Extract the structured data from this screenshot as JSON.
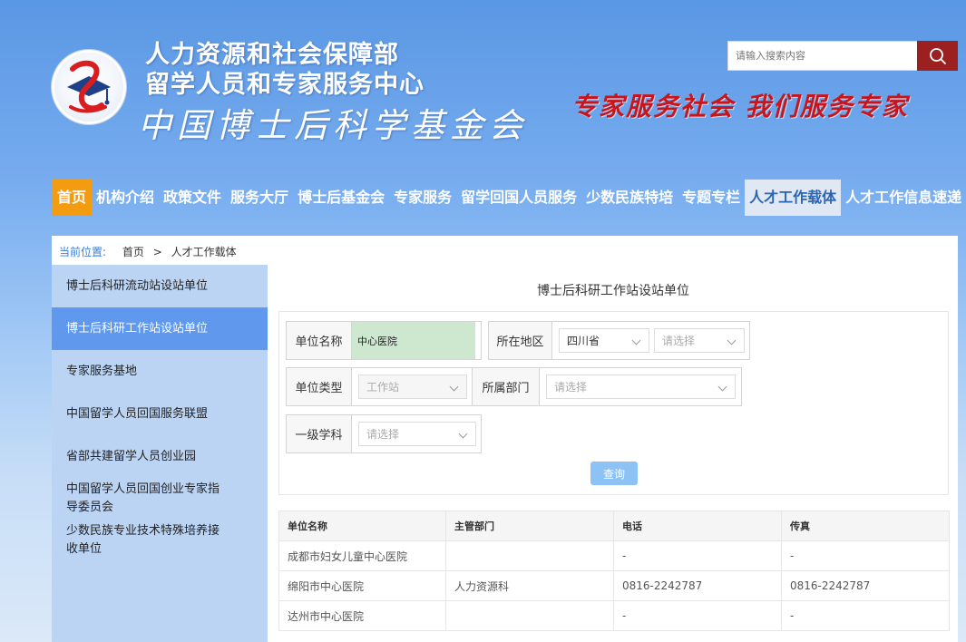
{
  "header": {
    "org_line1": "人力资源和社会保障部",
    "org_line2": "留学人员和专家服务中心",
    "org_line3": "中国博士后科学基金会",
    "slogan": "专家服务社会 我们服务专家",
    "search_placeholder": "请输入搜索内容"
  },
  "colors": {
    "accent_red": "#9d2020",
    "nav_home": "#f39b11",
    "sidebar_active": "#5f98ec",
    "slogan_red": "#c8151b"
  },
  "nav": [
    "首页",
    "机构介绍",
    "政策文件",
    "服务大厅",
    "博士后基金会",
    "专家服务",
    "留学回国人员服务",
    "少数民族特培",
    "专题专栏",
    "人才工作载体",
    "人才工作信息速递"
  ],
  "breadcrumb": {
    "label": "当前位置:",
    "home": "首页",
    "sep": ">",
    "current": "人才工作载体"
  },
  "sidebar": [
    "博士后科研流动站设站单位",
    "博士后科研工作站设站单位",
    "专家服务基地",
    "中国留学人员回国服务联盟",
    "省部共建留学人员创业园",
    "中国留学人员回国创业专家指导委员会",
    "少数民族专业技术特殊培养接收单位"
  ],
  "page_title": "博士后科研工作站设站单位",
  "form": {
    "unit_name_label": "单位名称",
    "unit_name_value": "中心医院",
    "region_label": "所在地区",
    "province_value": "四川省",
    "city_placeholder": "请选择",
    "unit_type_label": "单位类型",
    "unit_type_value": "工作站",
    "dept_label": "所属部门",
    "dept_placeholder": "请选择",
    "subject_label": "一级学科",
    "subject_placeholder": "请选择",
    "query_label": "查询"
  },
  "table": {
    "headers": [
      "单位名称",
      "主管部门",
      "电话",
      "传真"
    ],
    "rows": [
      [
        "成都市妇女儿童中心医院",
        "",
        "-",
        "-"
      ],
      [
        "绵阳市中心医院",
        "人力资源科",
        "0816-2242787",
        "0816-2242787"
      ],
      [
        "达州市中心医院",
        "",
        "-",
        "-"
      ]
    ]
  }
}
